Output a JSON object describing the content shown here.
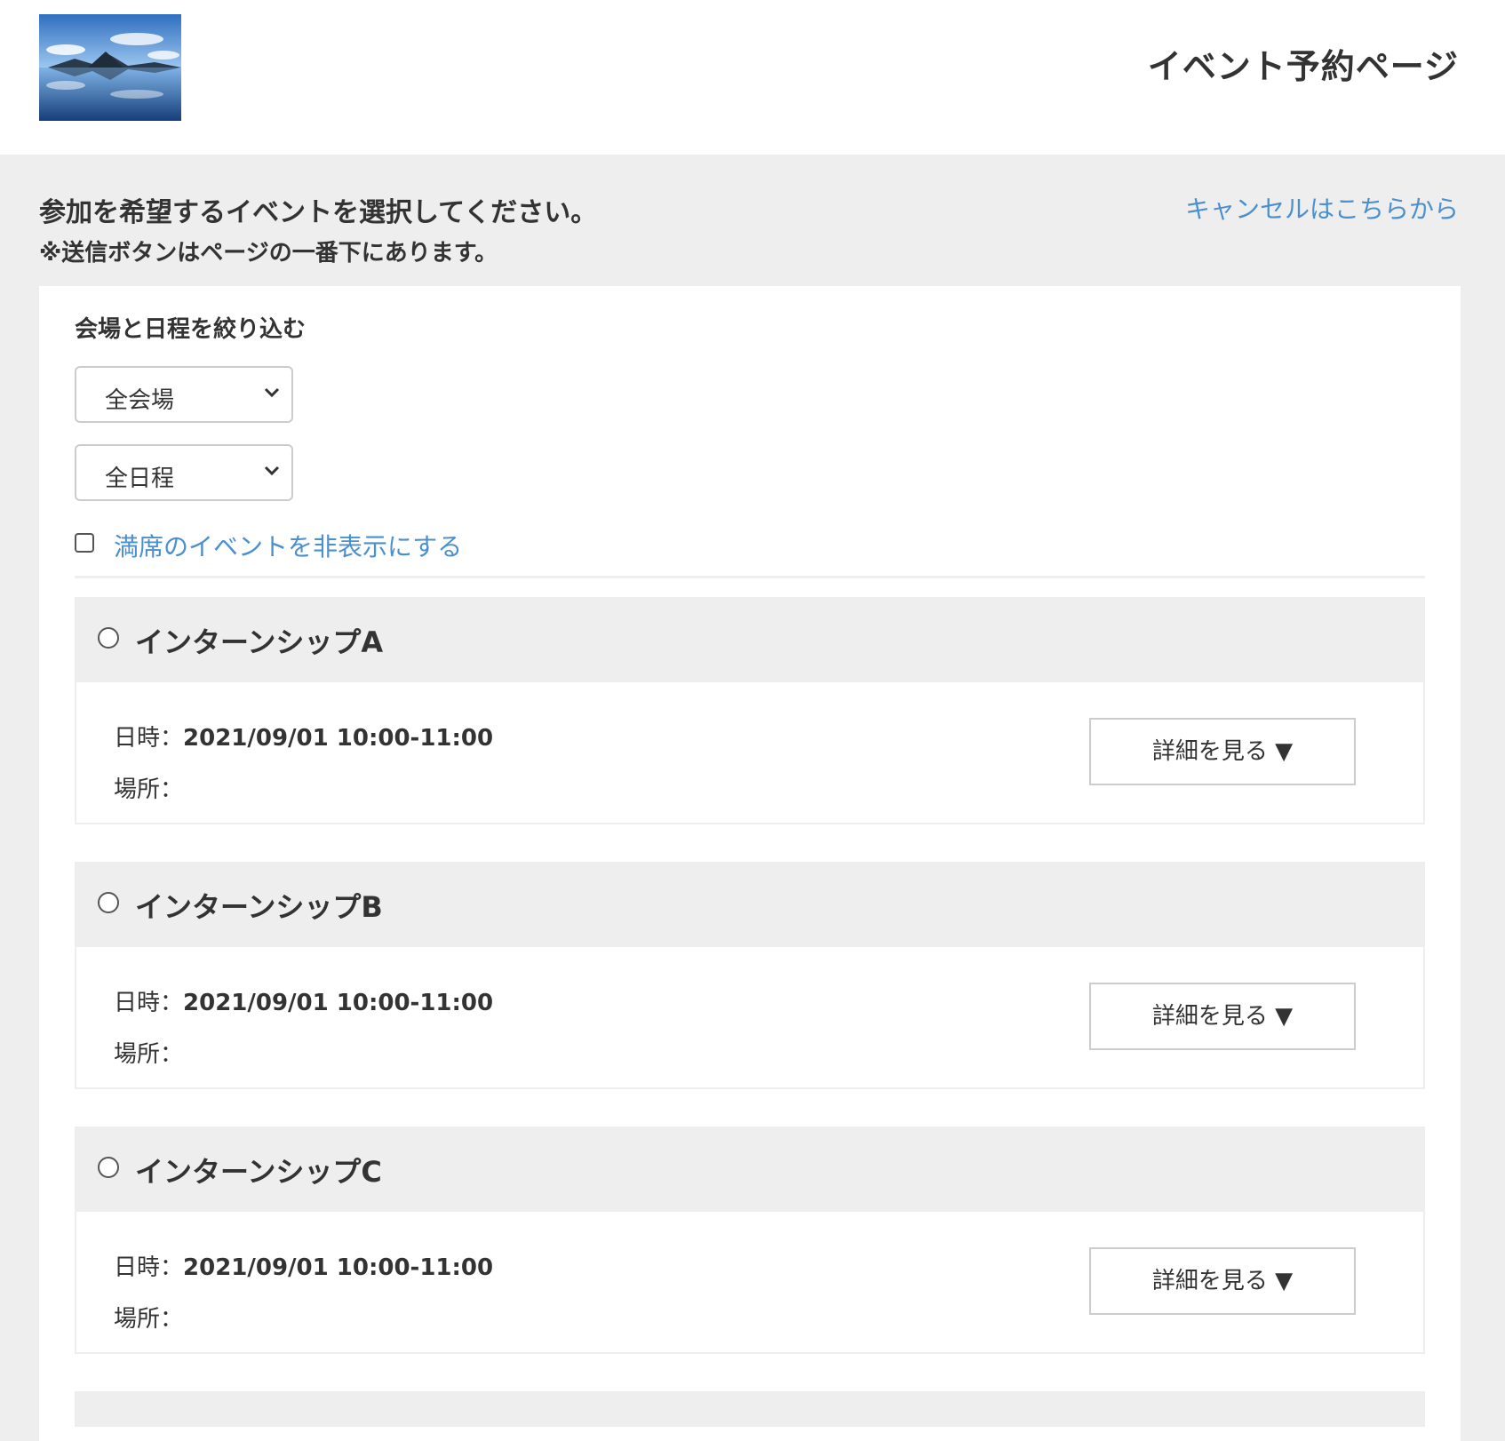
{
  "header": {
    "title": "イベント予約ページ"
  },
  "intro": {
    "heading": "参加を希望するイベントを選択してください。",
    "note": "※送信ボタンはページの一番下にあります。",
    "cancel_link": "キャンセルはこちらから"
  },
  "filter": {
    "title": "会場と日程を絞り込む",
    "venue_selected": "全会場",
    "date_selected": "全日程",
    "hide_full_label": "満席のイベントを非表示にする",
    "hide_full_checked": false
  },
  "events": [
    {
      "name": "インターンシップA",
      "date_key": "日時：",
      "date_value": "2021/09/01 10:00-11:00",
      "place_key": "場所：",
      "place_value": "",
      "detail_label": "詳細を見る ▼"
    },
    {
      "name": "インターンシップB",
      "date_key": "日時：",
      "date_value": "2021/09/01 10:00-11:00",
      "place_key": "場所：",
      "place_value": "",
      "detail_label": "詳細を見る ▼"
    },
    {
      "name": "インターンシップC",
      "date_key": "日時：",
      "date_value": "2021/09/01 10:00-11:00",
      "place_key": "場所：",
      "place_value": "",
      "detail_label": "詳細を見る ▼"
    }
  ],
  "colors": {
    "link": "#4a8fce",
    "background": "#eeeeee",
    "panel": "#ffffff",
    "text": "#333333"
  }
}
